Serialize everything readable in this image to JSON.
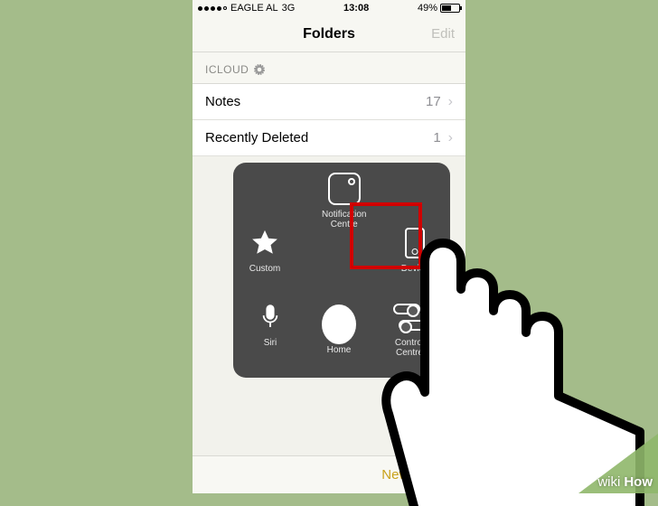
{
  "status": {
    "carrier": "EAGLE AL",
    "network": "3G",
    "time": "13:08",
    "battery_pct": "49%"
  },
  "nav": {
    "title": "Folders",
    "edit": "Edit"
  },
  "section": {
    "icloud": "ICLOUD"
  },
  "rows": {
    "notes": {
      "label": "Notes",
      "count": "17"
    },
    "deleted": {
      "label": "Recently Deleted",
      "count": "1"
    }
  },
  "toolbar": {
    "new_folder": "New Folder"
  },
  "assistive": {
    "notification": "Notification\nCentre",
    "custom": "Custom",
    "device": "Device",
    "siri": "Siri",
    "control": "Control\nCentre",
    "home": "Home"
  },
  "watermark": {
    "wiki": "wiki",
    "how": "How"
  }
}
